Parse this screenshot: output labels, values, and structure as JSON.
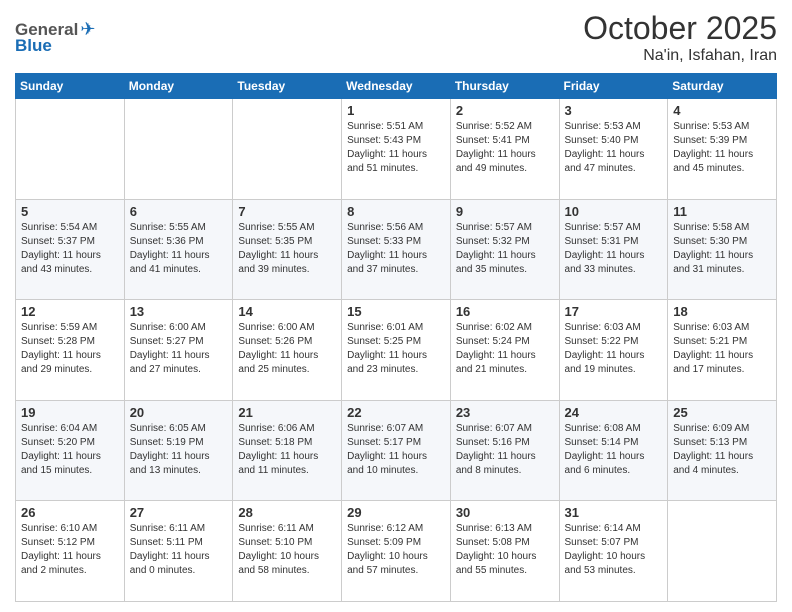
{
  "logo": {
    "general": "General",
    "blue": "Blue"
  },
  "title": "October 2025",
  "subtitle": "Na'in, Isfahan, Iran",
  "days_of_week": [
    "Sunday",
    "Monday",
    "Tuesday",
    "Wednesday",
    "Thursday",
    "Friday",
    "Saturday"
  ],
  "weeks": [
    [
      {
        "day": "",
        "info": ""
      },
      {
        "day": "",
        "info": ""
      },
      {
        "day": "",
        "info": ""
      },
      {
        "day": "1",
        "info": "Sunrise: 5:51 AM\nSunset: 5:43 PM\nDaylight: 11 hours\nand 51 minutes."
      },
      {
        "day": "2",
        "info": "Sunrise: 5:52 AM\nSunset: 5:41 PM\nDaylight: 11 hours\nand 49 minutes."
      },
      {
        "day": "3",
        "info": "Sunrise: 5:53 AM\nSunset: 5:40 PM\nDaylight: 11 hours\nand 47 minutes."
      },
      {
        "day": "4",
        "info": "Sunrise: 5:53 AM\nSunset: 5:39 PM\nDaylight: 11 hours\nand 45 minutes."
      }
    ],
    [
      {
        "day": "5",
        "info": "Sunrise: 5:54 AM\nSunset: 5:37 PM\nDaylight: 11 hours\nand 43 minutes."
      },
      {
        "day": "6",
        "info": "Sunrise: 5:55 AM\nSunset: 5:36 PM\nDaylight: 11 hours\nand 41 minutes."
      },
      {
        "day": "7",
        "info": "Sunrise: 5:55 AM\nSunset: 5:35 PM\nDaylight: 11 hours\nand 39 minutes."
      },
      {
        "day": "8",
        "info": "Sunrise: 5:56 AM\nSunset: 5:33 PM\nDaylight: 11 hours\nand 37 minutes."
      },
      {
        "day": "9",
        "info": "Sunrise: 5:57 AM\nSunset: 5:32 PM\nDaylight: 11 hours\nand 35 minutes."
      },
      {
        "day": "10",
        "info": "Sunrise: 5:57 AM\nSunset: 5:31 PM\nDaylight: 11 hours\nand 33 minutes."
      },
      {
        "day": "11",
        "info": "Sunrise: 5:58 AM\nSunset: 5:30 PM\nDaylight: 11 hours\nand 31 minutes."
      }
    ],
    [
      {
        "day": "12",
        "info": "Sunrise: 5:59 AM\nSunset: 5:28 PM\nDaylight: 11 hours\nand 29 minutes."
      },
      {
        "day": "13",
        "info": "Sunrise: 6:00 AM\nSunset: 5:27 PM\nDaylight: 11 hours\nand 27 minutes."
      },
      {
        "day": "14",
        "info": "Sunrise: 6:00 AM\nSunset: 5:26 PM\nDaylight: 11 hours\nand 25 minutes."
      },
      {
        "day": "15",
        "info": "Sunrise: 6:01 AM\nSunset: 5:25 PM\nDaylight: 11 hours\nand 23 minutes."
      },
      {
        "day": "16",
        "info": "Sunrise: 6:02 AM\nSunset: 5:24 PM\nDaylight: 11 hours\nand 21 minutes."
      },
      {
        "day": "17",
        "info": "Sunrise: 6:03 AM\nSunset: 5:22 PM\nDaylight: 11 hours\nand 19 minutes."
      },
      {
        "day": "18",
        "info": "Sunrise: 6:03 AM\nSunset: 5:21 PM\nDaylight: 11 hours\nand 17 minutes."
      }
    ],
    [
      {
        "day": "19",
        "info": "Sunrise: 6:04 AM\nSunset: 5:20 PM\nDaylight: 11 hours\nand 15 minutes."
      },
      {
        "day": "20",
        "info": "Sunrise: 6:05 AM\nSunset: 5:19 PM\nDaylight: 11 hours\nand 13 minutes."
      },
      {
        "day": "21",
        "info": "Sunrise: 6:06 AM\nSunset: 5:18 PM\nDaylight: 11 hours\nand 11 minutes."
      },
      {
        "day": "22",
        "info": "Sunrise: 6:07 AM\nSunset: 5:17 PM\nDaylight: 11 hours\nand 10 minutes."
      },
      {
        "day": "23",
        "info": "Sunrise: 6:07 AM\nSunset: 5:16 PM\nDaylight: 11 hours\nand 8 minutes."
      },
      {
        "day": "24",
        "info": "Sunrise: 6:08 AM\nSunset: 5:14 PM\nDaylight: 11 hours\nand 6 minutes."
      },
      {
        "day": "25",
        "info": "Sunrise: 6:09 AM\nSunset: 5:13 PM\nDaylight: 11 hours\nand 4 minutes."
      }
    ],
    [
      {
        "day": "26",
        "info": "Sunrise: 6:10 AM\nSunset: 5:12 PM\nDaylight: 11 hours\nand 2 minutes."
      },
      {
        "day": "27",
        "info": "Sunrise: 6:11 AM\nSunset: 5:11 PM\nDaylight: 11 hours\nand 0 minutes."
      },
      {
        "day": "28",
        "info": "Sunrise: 6:11 AM\nSunset: 5:10 PM\nDaylight: 10 hours\nand 58 minutes."
      },
      {
        "day": "29",
        "info": "Sunrise: 6:12 AM\nSunset: 5:09 PM\nDaylight: 10 hours\nand 57 minutes."
      },
      {
        "day": "30",
        "info": "Sunrise: 6:13 AM\nSunset: 5:08 PM\nDaylight: 10 hours\nand 55 minutes."
      },
      {
        "day": "31",
        "info": "Sunrise: 6:14 AM\nSunset: 5:07 PM\nDaylight: 10 hours\nand 53 minutes."
      },
      {
        "day": "",
        "info": ""
      }
    ]
  ]
}
